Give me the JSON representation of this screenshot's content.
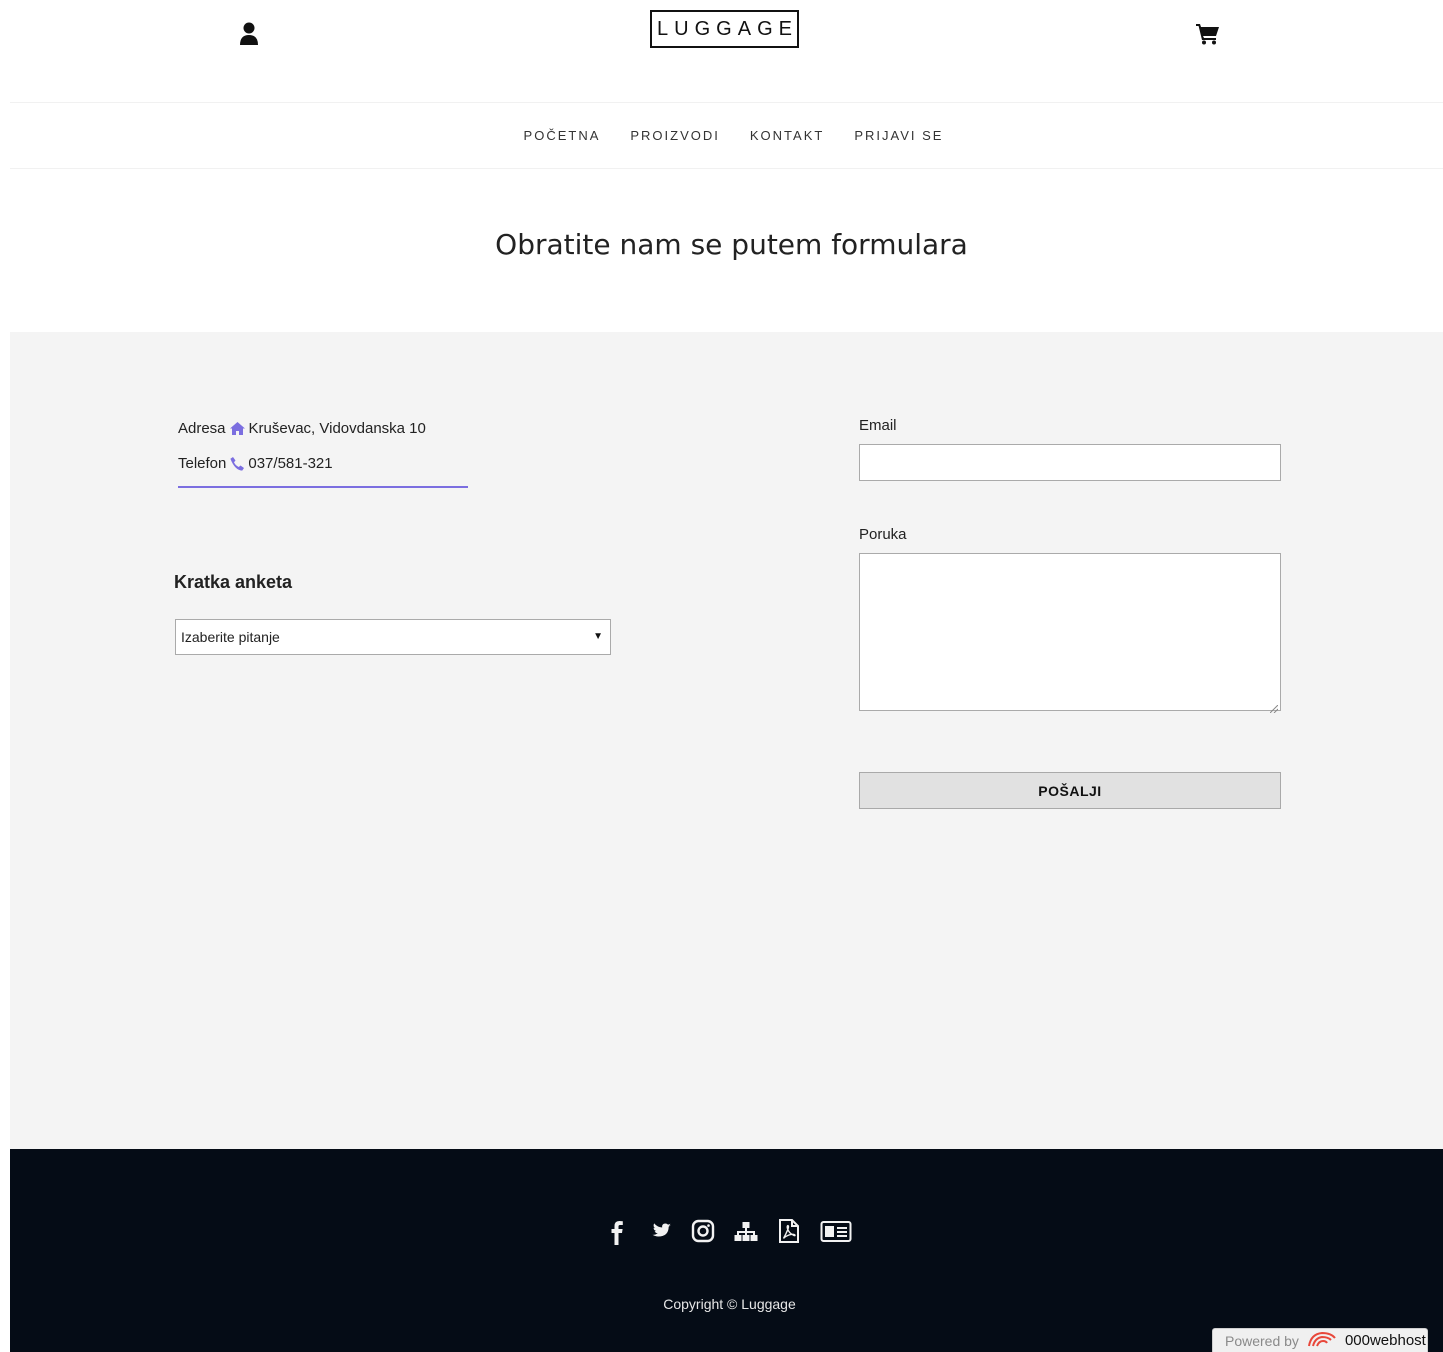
{
  "header": {
    "logo": "LUGGAGE",
    "icons": {
      "user": "user-icon",
      "cart": "cart-icon"
    }
  },
  "nav": {
    "items": [
      {
        "label": "POČETNA"
      },
      {
        "label": "PROIZVODI"
      },
      {
        "label": "KONTAKT"
      },
      {
        "label": "PRIJAVI SE"
      }
    ]
  },
  "page": {
    "title": "Obratite nam se putem formulara"
  },
  "contact": {
    "address_label": "Adresa",
    "address_value": "Kruševac, Vidovdanska 10",
    "phone_label": "Telefon",
    "phone_value": "037/581-321",
    "accent_color": "#7b6ee0"
  },
  "survey": {
    "title": "Kratka anketa",
    "selected": "Izaberite pitanje"
  },
  "form": {
    "email_label": "Email",
    "message_label": "Poruka",
    "submit_label": "POŠALJI"
  },
  "footer": {
    "social_icons": [
      "facebook-icon",
      "twitter-icon",
      "instagram-icon",
      "sitemap-icon",
      "pdf-icon",
      "id-card-icon"
    ],
    "copyright": "Copyright © Luggage"
  },
  "badge": {
    "prefix": "Powered by",
    "brand": "000webhost"
  }
}
